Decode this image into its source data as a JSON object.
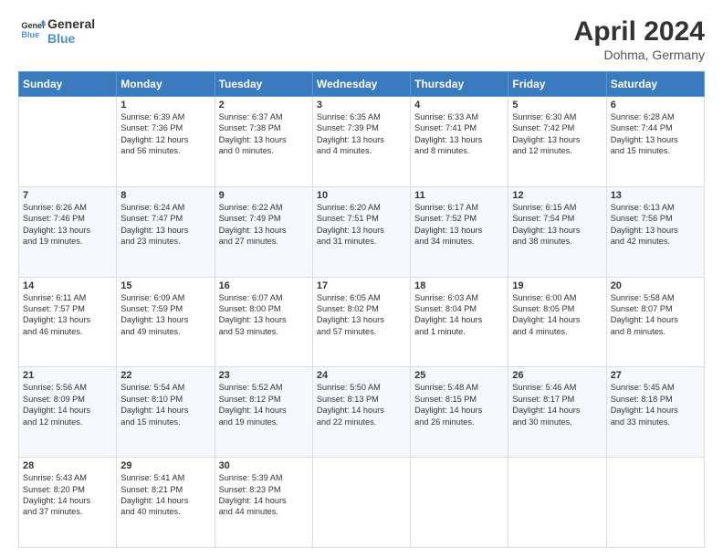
{
  "header": {
    "logo_line1": "General",
    "logo_line2": "Blue",
    "month": "April 2024",
    "location": "Dohma, Germany"
  },
  "weekdays": [
    "Sunday",
    "Monday",
    "Tuesday",
    "Wednesday",
    "Thursday",
    "Friday",
    "Saturday"
  ],
  "weeks": [
    [
      {
        "day": "",
        "text": ""
      },
      {
        "day": "1",
        "text": "Sunrise: 6:39 AM\nSunset: 7:36 PM\nDaylight: 12 hours\nand 56 minutes."
      },
      {
        "day": "2",
        "text": "Sunrise: 6:37 AM\nSunset: 7:38 PM\nDaylight: 13 hours\nand 0 minutes."
      },
      {
        "day": "3",
        "text": "Sunrise: 6:35 AM\nSunset: 7:39 PM\nDaylight: 13 hours\nand 4 minutes."
      },
      {
        "day": "4",
        "text": "Sunrise: 6:33 AM\nSunset: 7:41 PM\nDaylight: 13 hours\nand 8 minutes."
      },
      {
        "day": "5",
        "text": "Sunrise: 6:30 AM\nSunset: 7:42 PM\nDaylight: 13 hours\nand 12 minutes."
      },
      {
        "day": "6",
        "text": "Sunrise: 6:28 AM\nSunset: 7:44 PM\nDaylight: 13 hours\nand 15 minutes."
      }
    ],
    [
      {
        "day": "7",
        "text": "Sunrise: 6:26 AM\nSunset: 7:46 PM\nDaylight: 13 hours\nand 19 minutes."
      },
      {
        "day": "8",
        "text": "Sunrise: 6:24 AM\nSunset: 7:47 PM\nDaylight: 13 hours\nand 23 minutes."
      },
      {
        "day": "9",
        "text": "Sunrise: 6:22 AM\nSunset: 7:49 PM\nDaylight: 13 hours\nand 27 minutes."
      },
      {
        "day": "10",
        "text": "Sunrise: 6:20 AM\nSunset: 7:51 PM\nDaylight: 13 hours\nand 31 minutes."
      },
      {
        "day": "11",
        "text": "Sunrise: 6:17 AM\nSunset: 7:52 PM\nDaylight: 13 hours\nand 34 minutes."
      },
      {
        "day": "12",
        "text": "Sunrise: 6:15 AM\nSunset: 7:54 PM\nDaylight: 13 hours\nand 38 minutes."
      },
      {
        "day": "13",
        "text": "Sunrise: 6:13 AM\nSunset: 7:56 PM\nDaylight: 13 hours\nand 42 minutes."
      }
    ],
    [
      {
        "day": "14",
        "text": "Sunrise: 6:11 AM\nSunset: 7:57 PM\nDaylight: 13 hours\nand 46 minutes."
      },
      {
        "day": "15",
        "text": "Sunrise: 6:09 AM\nSunset: 7:59 PM\nDaylight: 13 hours\nand 49 minutes."
      },
      {
        "day": "16",
        "text": "Sunrise: 6:07 AM\nSunset: 8:00 PM\nDaylight: 13 hours\nand 53 minutes."
      },
      {
        "day": "17",
        "text": "Sunrise: 6:05 AM\nSunset: 8:02 PM\nDaylight: 13 hours\nand 57 minutes."
      },
      {
        "day": "18",
        "text": "Sunrise: 6:03 AM\nSunset: 8:04 PM\nDaylight: 14 hours\nand 1 minute."
      },
      {
        "day": "19",
        "text": "Sunrise: 6:00 AM\nSunset: 8:05 PM\nDaylight: 14 hours\nand 4 minutes."
      },
      {
        "day": "20",
        "text": "Sunrise: 5:58 AM\nSunset: 8:07 PM\nDaylight: 14 hours\nand 8 minutes."
      }
    ],
    [
      {
        "day": "21",
        "text": "Sunrise: 5:56 AM\nSunset: 8:09 PM\nDaylight: 14 hours\nand 12 minutes."
      },
      {
        "day": "22",
        "text": "Sunrise: 5:54 AM\nSunset: 8:10 PM\nDaylight: 14 hours\nand 15 minutes."
      },
      {
        "day": "23",
        "text": "Sunrise: 5:52 AM\nSunset: 8:12 PM\nDaylight: 14 hours\nand 19 minutes."
      },
      {
        "day": "24",
        "text": "Sunrise: 5:50 AM\nSunset: 8:13 PM\nDaylight: 14 hours\nand 22 minutes."
      },
      {
        "day": "25",
        "text": "Sunrise: 5:48 AM\nSunset: 8:15 PM\nDaylight: 14 hours\nand 26 minutes."
      },
      {
        "day": "26",
        "text": "Sunrise: 5:46 AM\nSunset: 8:17 PM\nDaylight: 14 hours\nand 30 minutes."
      },
      {
        "day": "27",
        "text": "Sunrise: 5:45 AM\nSunset: 8:18 PM\nDaylight: 14 hours\nand 33 minutes."
      }
    ],
    [
      {
        "day": "28",
        "text": "Sunrise: 5:43 AM\nSunset: 8:20 PM\nDaylight: 14 hours\nand 37 minutes."
      },
      {
        "day": "29",
        "text": "Sunrise: 5:41 AM\nSunset: 8:21 PM\nDaylight: 14 hours\nand 40 minutes."
      },
      {
        "day": "30",
        "text": "Sunrise: 5:39 AM\nSunset: 8:23 PM\nDaylight: 14 hours\nand 44 minutes."
      },
      {
        "day": "",
        "text": ""
      },
      {
        "day": "",
        "text": ""
      },
      {
        "day": "",
        "text": ""
      },
      {
        "day": "",
        "text": ""
      }
    ]
  ]
}
